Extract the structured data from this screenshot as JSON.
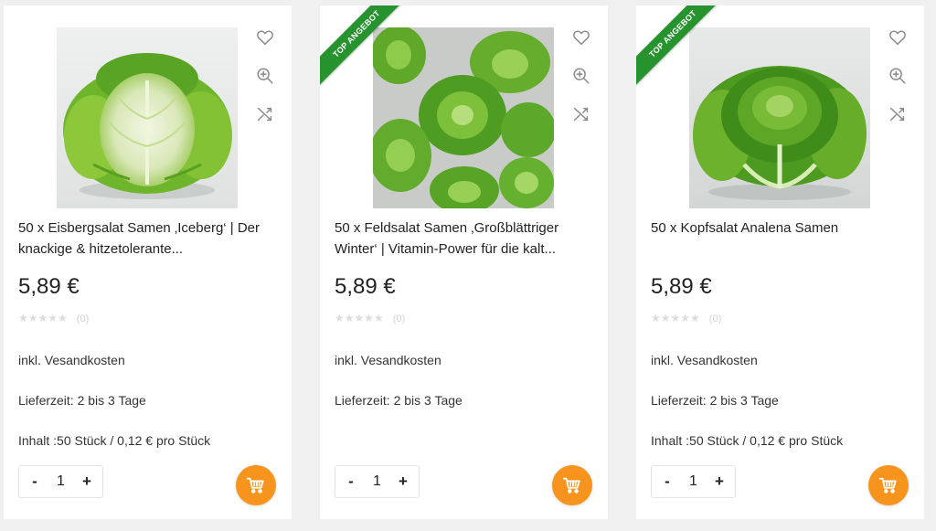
{
  "colors": {
    "accent": "#f7941d",
    "ribbon": "#27932f",
    "page_background": "#f0f0f0",
    "card_background": "#ffffff"
  },
  "icons": {
    "wishlist": "heart-icon",
    "zoom": "zoom-in-icon",
    "compare": "shuffle-icon",
    "cart": "cart-icon"
  },
  "products": [
    {
      "ribbon": "",
      "image_alt": "Eisbergsalat",
      "title": "50 x Eisbergsalat Samen ‚Iceberg‘ | Der knackige & hitzetolerante...",
      "price": "5,89 €",
      "stars": "★★★★★",
      "rating_value": 0,
      "rating_count": "(0)",
      "shipping": "inkl. Vesandkosten",
      "delivery": "Lieferzeit: 2 bis 3 Tage",
      "content": "Inhalt :50 Stück / 0,12 € pro Stück",
      "quantity": "1",
      "qty_minus": "-",
      "qty_plus": "+"
    },
    {
      "ribbon": "TOP ANGEBOT",
      "image_alt": "Feldsalat",
      "title": "50 x Feldsalat Samen ‚Großblättriger Winter‘ | Vitamin-Power für die kalt...",
      "price": "5,89 €",
      "stars": "★★★★★",
      "rating_value": 0,
      "rating_count": "(0)",
      "shipping": "inkl. Vesandkosten",
      "delivery": "Lieferzeit: 2 bis 3 Tage",
      "content": "",
      "quantity": "1",
      "qty_minus": "-",
      "qty_plus": "+"
    },
    {
      "ribbon": "TOP ANGEBOT",
      "image_alt": "Kopfsalat",
      "title": "50 x Kopfsalat Analena Samen",
      "price": "5,89 €",
      "stars": "★★★★★",
      "rating_value": 0,
      "rating_count": "(0)",
      "shipping": "inkl. Vesandkosten",
      "delivery": "Lieferzeit: 2 bis 3 Tage",
      "content": "Inhalt :50 Stück / 0,12 € pro Stück",
      "quantity": "1",
      "qty_minus": "-",
      "qty_plus": "+"
    }
  ]
}
